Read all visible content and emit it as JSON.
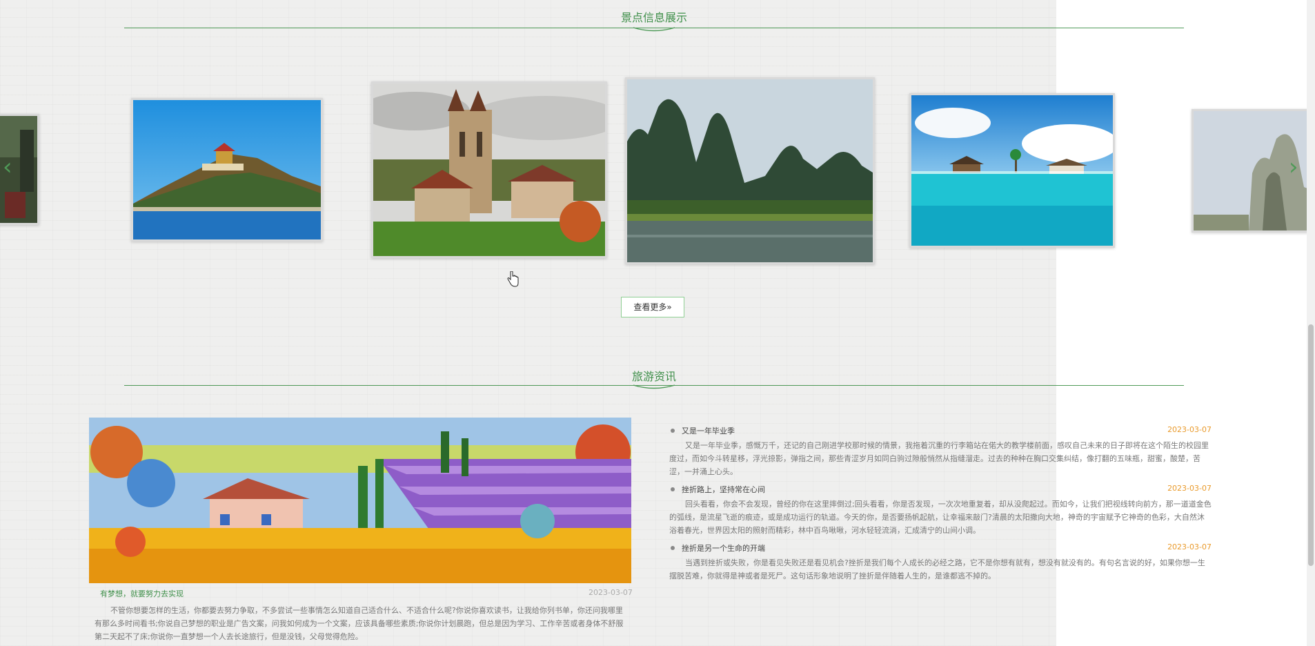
{
  "sections": {
    "scenic_title": "景点信息展示",
    "news_title": "旅游资讯"
  },
  "carousel": {
    "prev_icon": "chevron-left-icon",
    "next_icon": "chevron-right-icon",
    "more_label": "查看更多»"
  },
  "featured": {
    "title": "有梦想，就要努力去实现",
    "date": "2023-03-07",
    "summary": "不管你想要怎样的生活，你都要去努力争取，不多尝试一些事情怎么知道自己适合什么、不适合什么呢?你说你喜欢读书，让我给你列书单，你还问我哪里有那么多时间看书;你说自己梦想的职业是广告文案，问我如何成为一个文案，应该具备哪些素质;你说你计划晨跑，但总是因为学习、工作辛苦或者身体不舒服第二天起不了床;你说你一直梦想一个人去长途旅行，但是没钱，父母觉得危险。"
  },
  "news": [
    {
      "title": "又是一年毕业季",
      "date": "2023-03-07",
      "summary": "又是一年毕业季，感慨万千，还记的自己刚进学校那时候的情景，我拖着沉重的行李箱站在偌大的教学楼前面，感叹自己未来的日子即将在这个陌生的校园里度过，而如今斗转星移，浮光掠影，弹指之间，那些青涩岁月如同白驹过隙般悄然从指缝溜走。过去的种种在胸口交集纠结，像打翻的五味瓶，甜蜜，酸楚，苦涩，一并涌上心头。"
    },
    {
      "title": "挫折路上，坚持常在心间",
      "date": "2023-03-07",
      "summary": "回头看看，你会不会发现，曾经的你在这里摔倒过;回头看看，你是否发现，一次次地重复着，却从没爬起过。而如今，让我们把视线转向前方，那一道道金色的弧线，是流星飞逝的痕迹，或是成功运行的轨道。今天的你，是否要扬帆起航，让幸福来敲门?清晨的太阳撒向大地，神奇的宇宙赋予它神奇的色彩，大自然沐浴着春光，世界因太阳的照射而精彩，林中百鸟啾啾，河水轻轻流淌，汇成清宁的山间小调。"
    },
    {
      "title": "挫折是另一个生命的开端",
      "date": "2023-03-07",
      "summary": "当遇到挫折或失败，你是看见失败还是看见机会?挫折是我们每个人成长的必经之路，它不是你想有就有，想没有就没有的。有句名言说的好，如果你想一生摆脱苦难，你就得是神或者是死尸。这句话形象地说明了挫折是伴随着人生的，是谁都逃不掉的。"
    }
  ]
}
